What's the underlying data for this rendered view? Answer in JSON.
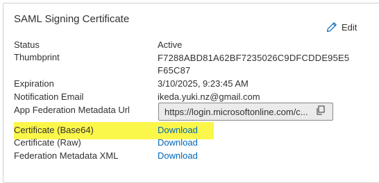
{
  "card": {
    "title": "SAML Signing Certificate",
    "edit_label": "Edit"
  },
  "fields": {
    "status_label": "Status",
    "status_value": "Active",
    "thumbprint_label": "Thumbprint",
    "thumbprint_line1": "F7288ABD81A62BF7235026C9DFCDDE95E5",
    "thumbprint_line2": "F65C87",
    "expiration_label": "Expiration",
    "expiration_value": "3/10/2025, 9:23:45 AM",
    "notification_label": "Notification Email",
    "notification_value": "ikeda.yuki.nz@gmail.com",
    "metadata_url_label": "App Federation Metadata Url",
    "metadata_url_value": "https://login.microsoftonline.com/c...",
    "cert_base64_label": "Certificate (Base64)",
    "cert_base64_link": "Download",
    "cert_raw_label": "Certificate (Raw)",
    "cert_raw_link": "Download",
    "fed_xml_label": "Federation Metadata XML",
    "fed_xml_link": "Download"
  },
  "colors": {
    "link": "#0067b8",
    "highlight": "#fbf64a",
    "border": "#d2d0ce"
  },
  "icons": {
    "edit": "pencil-icon",
    "copy": "copy-icon"
  }
}
